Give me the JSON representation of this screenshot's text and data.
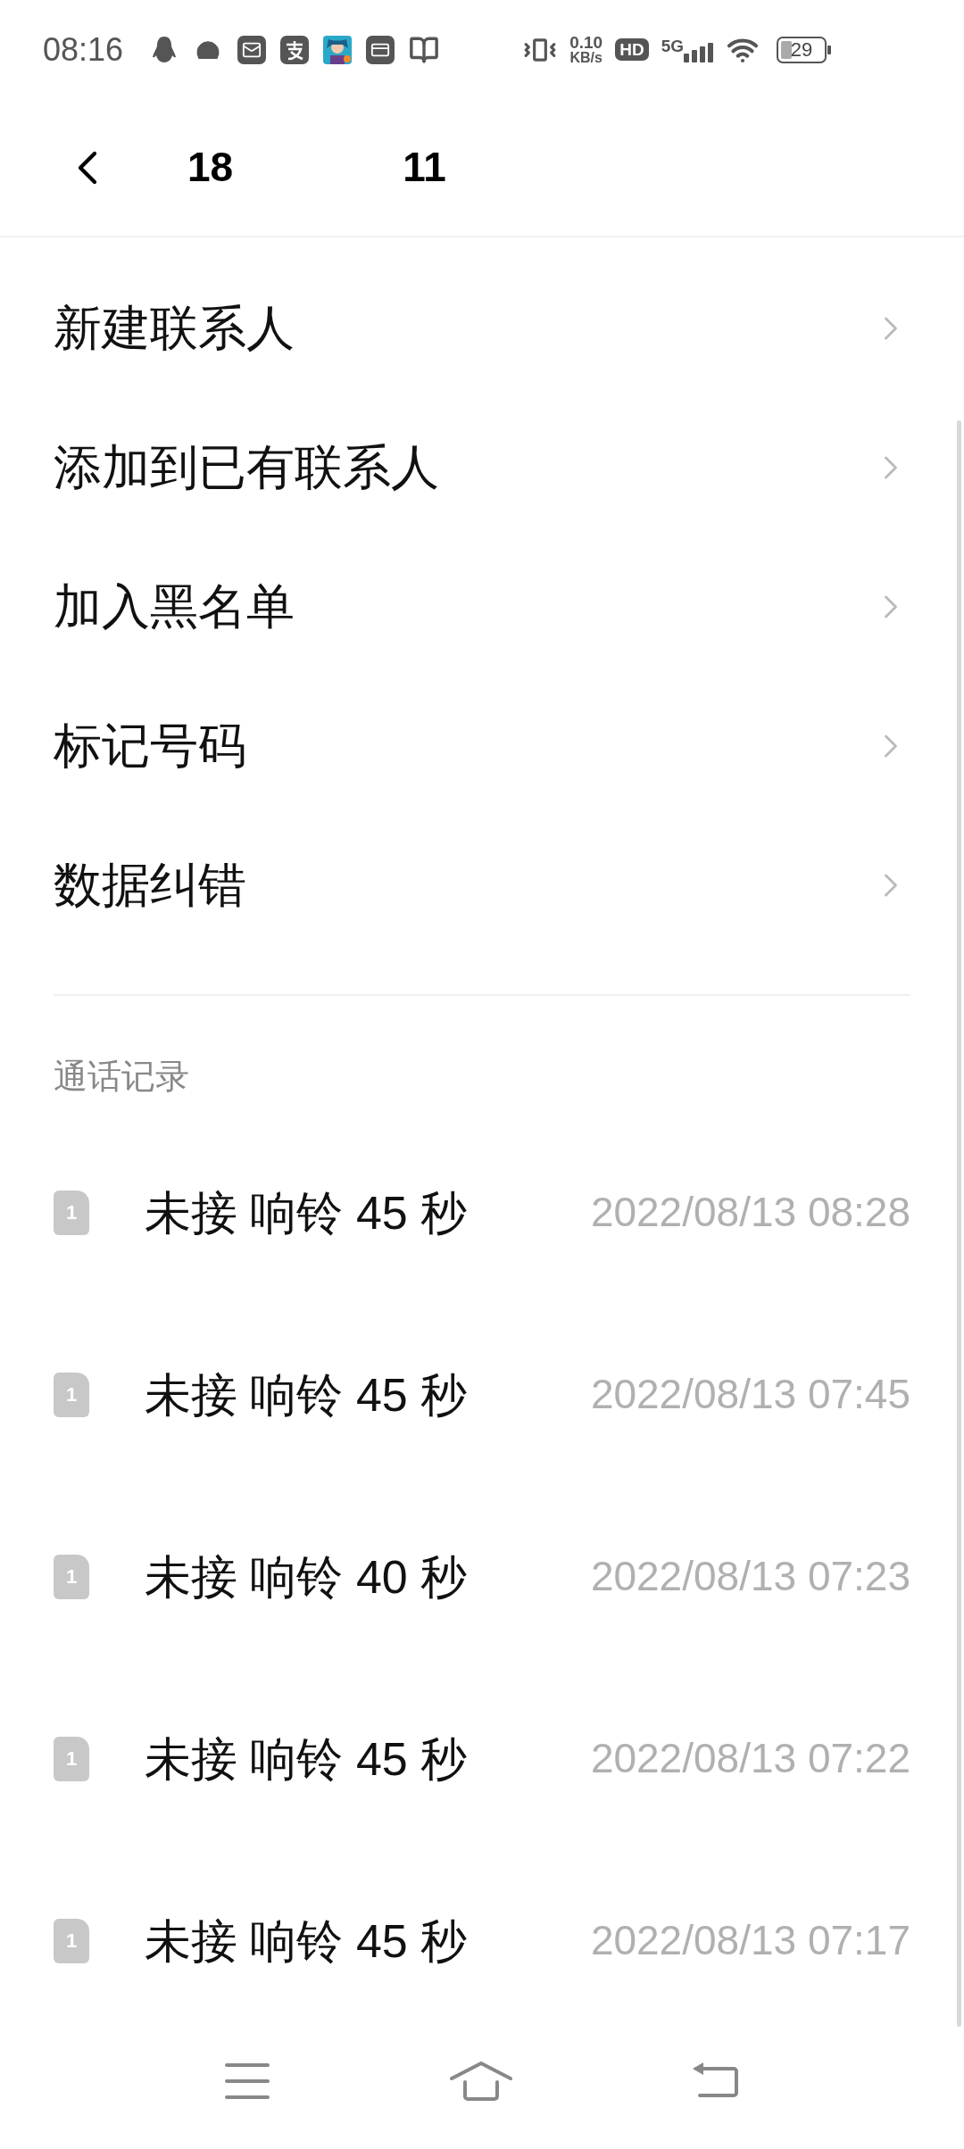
{
  "status_bar": {
    "time": "08:16",
    "speed_value": "0.10",
    "speed_unit": "KB/s",
    "hd": "HD",
    "network": "5G",
    "battery": "29"
  },
  "header": {
    "title_start": "18",
    "title_end": "11"
  },
  "menu": [
    {
      "label": "新建联系人"
    },
    {
      "label": "添加到已有联系人"
    },
    {
      "label": "加入黑名单"
    },
    {
      "label": "标记号码"
    },
    {
      "label": "数据纠错"
    }
  ],
  "call_log": {
    "heading": "通话记录",
    "rows": [
      {
        "sim": "1",
        "status": "未接 响铃 45 秒",
        "time": "2022/08/13 08:28"
      },
      {
        "sim": "1",
        "status": "未接 响铃 45 秒",
        "time": "2022/08/13 07:45"
      },
      {
        "sim": "1",
        "status": "未接 响铃 40 秒",
        "time": "2022/08/13 07:23"
      },
      {
        "sim": "1",
        "status": "未接 响铃 45 秒",
        "time": "2022/08/13 07:22"
      },
      {
        "sim": "1",
        "status": "未接 响铃 45 秒",
        "time": "2022/08/13 07:17"
      }
    ]
  }
}
